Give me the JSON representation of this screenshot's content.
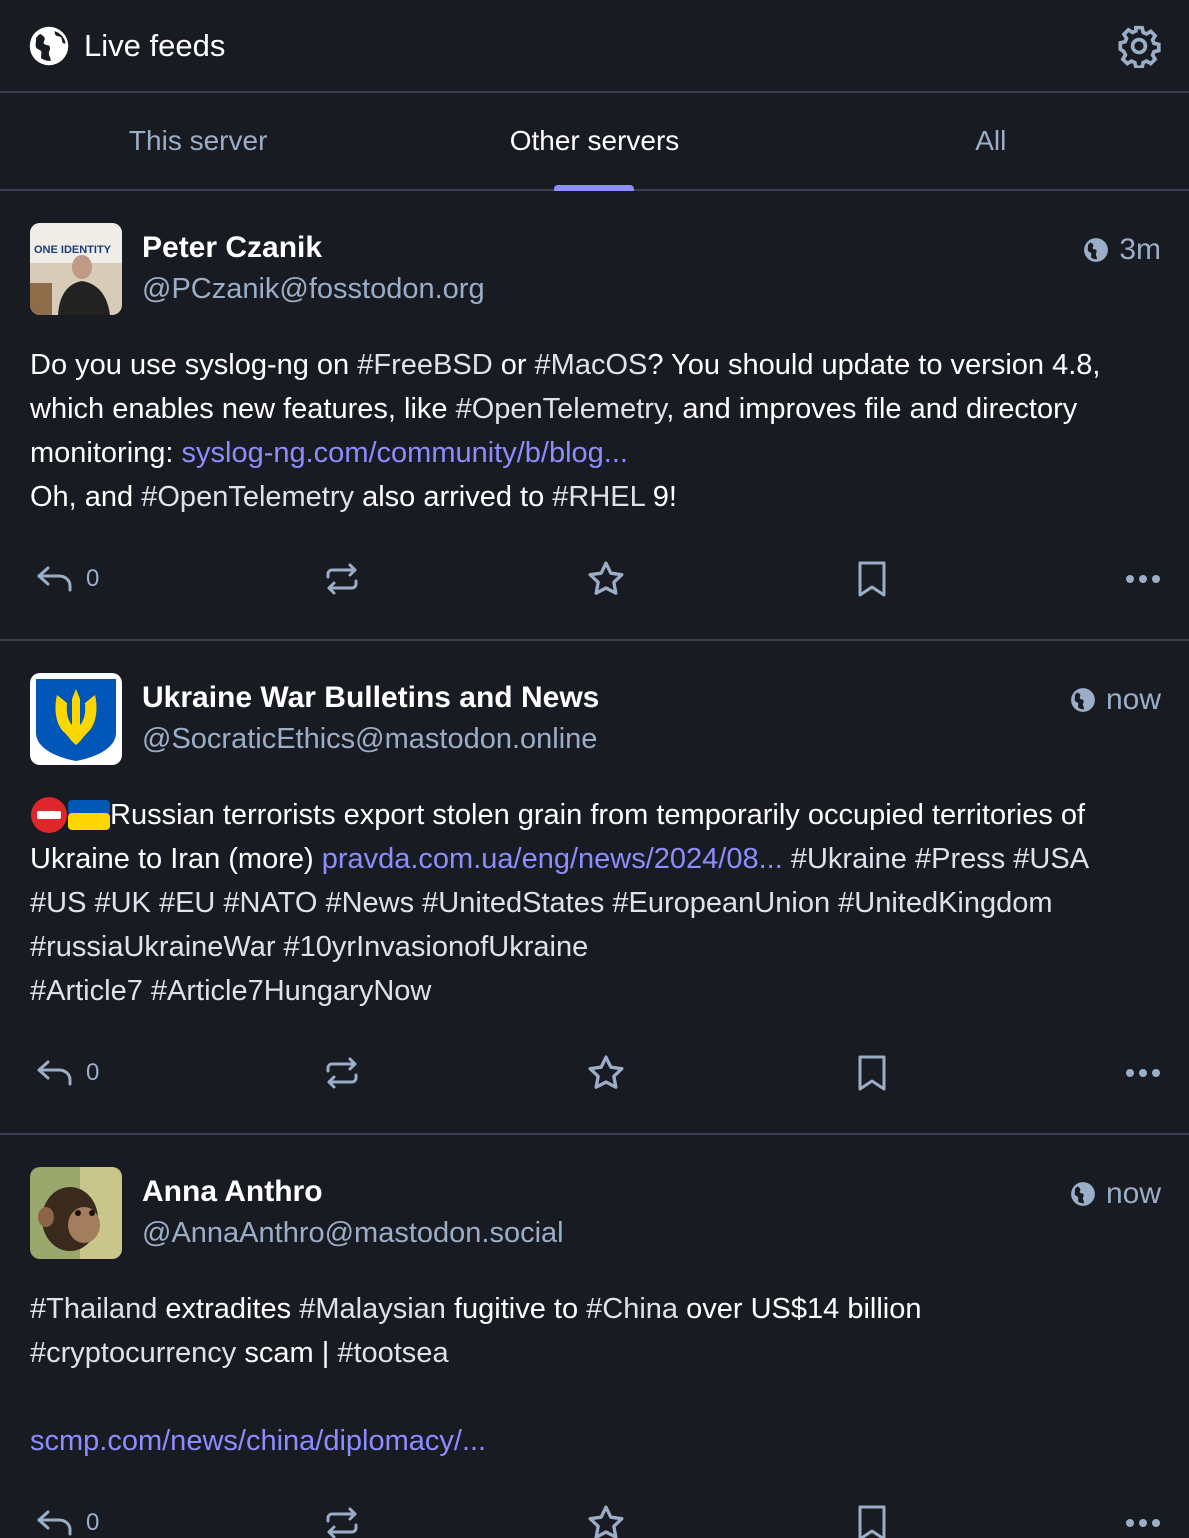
{
  "header": {
    "title": "Live feeds",
    "globe_icon": "globe-icon",
    "settings_icon": "gear-icon"
  },
  "tabs": [
    {
      "label": "This server",
      "active": false
    },
    {
      "label": "Other servers",
      "active": true
    },
    {
      "label": "All",
      "active": false
    }
  ],
  "posts": [
    {
      "display_name": "Peter Czanik",
      "handle": "@PCzanik@fosstodon.org",
      "time": "3m",
      "avatar_text": "ONE IDENTITY",
      "content": {
        "l1_a": "Do you use syslog-ng on ",
        "l1_t1": "#FreeBSD",
        "l1_b": " or ",
        "l1_t2": "#MacOS",
        "l1_c": "? You should update to version 4.8,",
        "l2_a": "which enables new features, like ",
        "l2_t1": "#OpenTelemetry",
        "l2_b": ", and improves file and directory",
        "l3_a": "monitoring: ",
        "l3_link": "syslog-ng.com/community/b/blog...",
        "l4_a": "Oh, and ",
        "l4_t1": "#OpenTelemetry",
        "l4_b": " also arrived to ",
        "l4_t2": "#RHEL",
        "l4_c": " 9!"
      },
      "reply_count": "0"
    },
    {
      "display_name": "Ukraine War Bulletins and News",
      "handle": "@SocraticEthics@mastodon.online",
      "time": "now",
      "content": {
        "l1_a": "Russian terrorists export stolen grain from temporarily occupied territories of",
        "l2_a": "Ukraine to Iran (more) ",
        "l2_link": "pravda.com.ua/eng/news/2024/08...",
        "l2_b": " #Ukraine #Press #USA",
        "l3": "#US #UK #EU #NATO #News #UnitedStates #EuropeanUnion #UnitedKingdom",
        "l4": "#russiaUkraineWar #10yrInvasionofUkraine",
        "l5": "#Article7 #Article7HungaryNow"
      },
      "reply_count": "0"
    },
    {
      "display_name": "Anna Anthro",
      "handle": "@AnnaAnthro@mastodon.social",
      "time": "now",
      "content": {
        "l1_t1": "#Thailand",
        "l1_a": " extradites ",
        "l1_t2": "#Malaysian",
        "l1_b": " fugitive to ",
        "l1_t3": "#China",
        "l1_c": " over US$14 billion",
        "l2_t1": "#cryptocurrency",
        "l2_a": " scam | ",
        "l2_t2": "#tootsea",
        "l3_link": "scmp.com/news/china/diplomacy/..."
      },
      "reply_count": "0"
    }
  ],
  "colors": {
    "background": "#191b22",
    "accent": "#8c8dff",
    "muted": "#9baec8",
    "divider": "#393f4f"
  }
}
